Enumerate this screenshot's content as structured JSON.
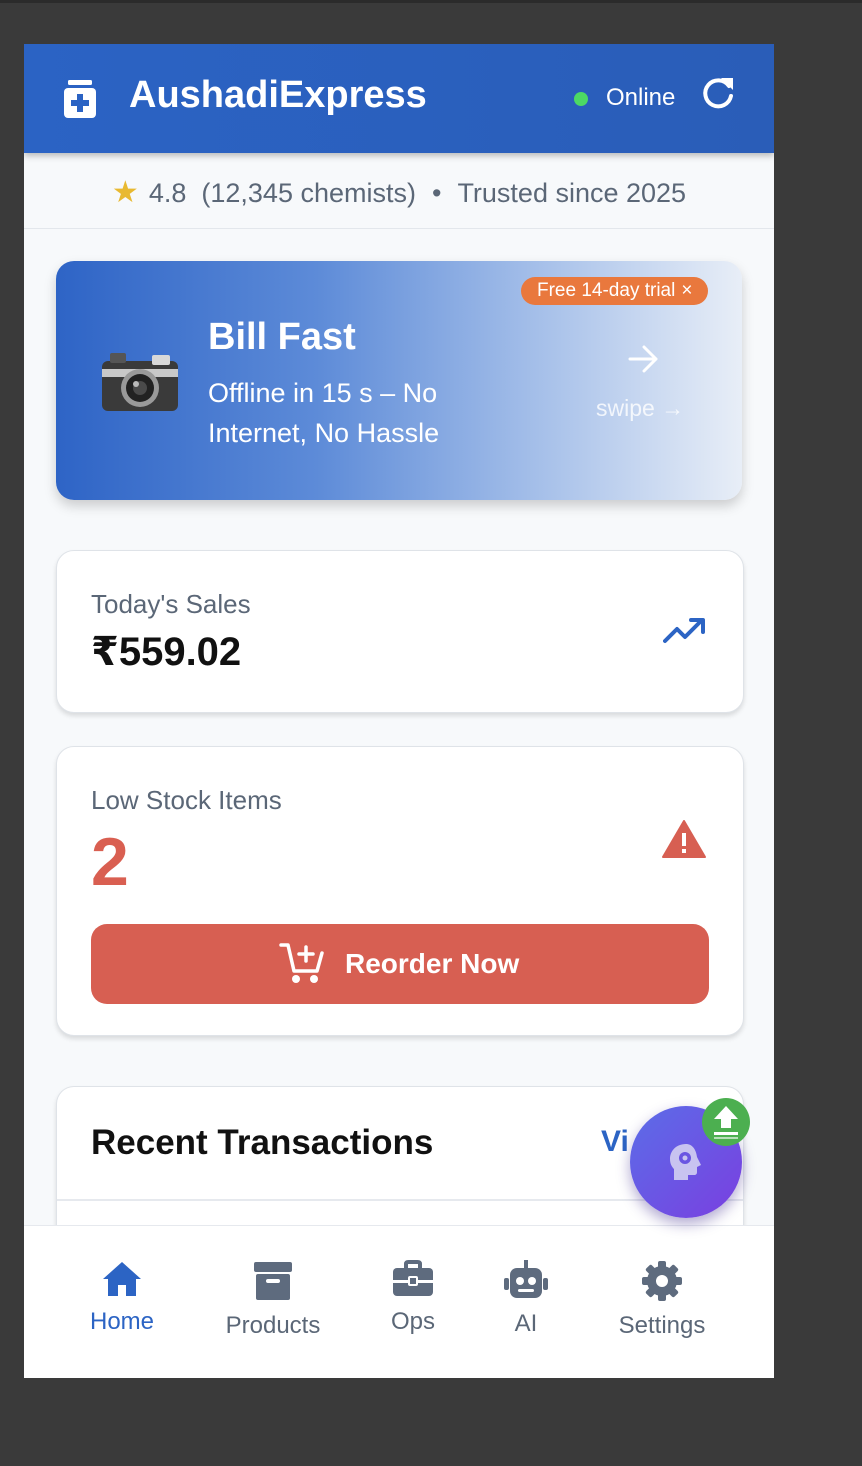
{
  "header": {
    "app_title": "AushadiExpress",
    "status": "Online",
    "status_color": "#4cd964",
    "brand_color": "#2b63c4"
  },
  "rating_bar": {
    "rating": "4.8",
    "count": "(12,345 chemists)",
    "separator": "•",
    "trusted": "Trusted since 2025"
  },
  "promo": {
    "title": "Bill Fast",
    "subtitle": "Offline in 15 s – No Internet, No Hassle",
    "badge": "Free 14-day trial",
    "badge_close": "×",
    "swipe": "swipe →",
    "emoji": "camera"
  },
  "sales": {
    "label": "Today's Sales",
    "value": "₹559.02",
    "icon": "trending-up-icon"
  },
  "stock": {
    "label": "Low Stock Items",
    "value": "2",
    "icon": "warning-icon",
    "button_label": "Reorder Now",
    "accent_color": "#d75f52"
  },
  "transactions": {
    "title": "Recent Transactions",
    "view_link": "Vi"
  },
  "nav": {
    "items": [
      {
        "label": "Home",
        "icon": "home-icon",
        "active": true
      },
      {
        "label": "Products",
        "icon": "archive-icon",
        "active": false
      },
      {
        "label": "Ops",
        "icon": "briefcase-icon",
        "active": false
      },
      {
        "label": "AI",
        "icon": "robot-icon",
        "active": false
      },
      {
        "label": "Settings",
        "icon": "gear-icon",
        "active": false
      }
    ]
  }
}
